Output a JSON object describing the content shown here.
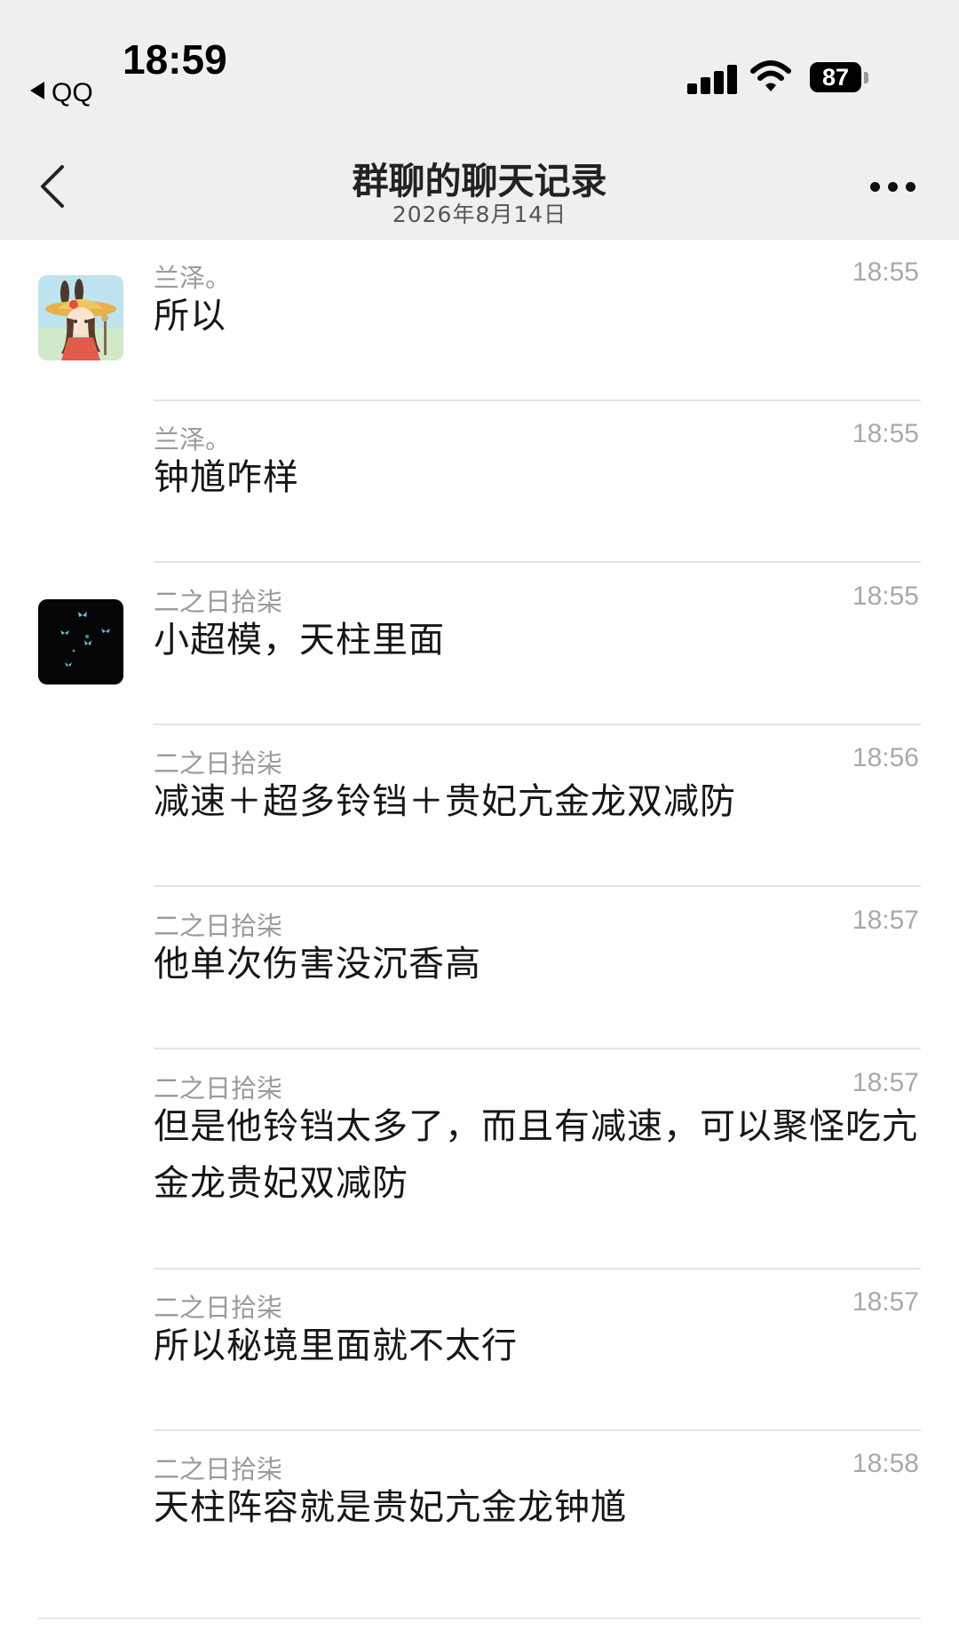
{
  "status_bar": {
    "time": "18:59",
    "back_app": "QQ",
    "battery": "87"
  },
  "header": {
    "title": "群聊的聊天记录",
    "subtitle": "2026年8月14日"
  },
  "colors": {
    "header_bg": "#efefef",
    "divider": "#e4e4e4",
    "meta_text": "#9a9a9a"
  },
  "messages": [
    {
      "sender": "兰泽。",
      "time": "18:55",
      "text": "所以",
      "avatar": "anime-girl-avatar"
    },
    {
      "sender": "兰泽。",
      "time": "18:55",
      "text": "钟馗咋样"
    },
    {
      "sender": "二之日拾柒",
      "time": "18:55",
      "text": "小超模，天柱里面",
      "avatar": "butterfly-avatar"
    },
    {
      "sender": "二之日拾柒",
      "time": "18:56",
      "text": "减速＋超多铃铛＋贵妃亢金龙双减防"
    },
    {
      "sender": "二之日拾柒",
      "time": "18:57",
      "text": "他单次伤害没沉香高"
    },
    {
      "sender": "二之日拾柒",
      "time": "18:57",
      "text": "但是他铃铛太多了，而且有减速，可以聚怪吃亢金龙贵妃双减防"
    },
    {
      "sender": "二之日拾柒",
      "time": "18:57",
      "text": "所以秘境里面就不太行"
    },
    {
      "sender": "二之日拾柒",
      "time": "18:58",
      "text": "天柱阵容就是贵妃亢金龙钟馗"
    }
  ]
}
